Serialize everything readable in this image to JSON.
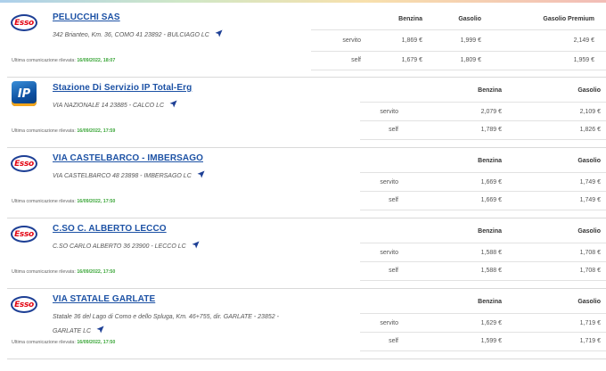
{
  "stations": [
    {
      "logo": "esso",
      "logo_text": "Esso",
      "name": "PELUCCHI SAS",
      "address_lines": [
        "342 Brianteo, Km. 36, COMO 41 23892 - BULCIAGO LC"
      ],
      "last_update_label": "Ultima comunicazione rilevata:",
      "last_update_date": "16/09/2022, 18:07",
      "fuels": [
        "Benzina",
        "Gasolio",
        "Gasolio Premium"
      ],
      "rows": [
        {
          "label": "servito",
          "prices": [
            "1,869 €",
            "1,999 €",
            "2,149 €"
          ]
        },
        {
          "label": "self",
          "prices": [
            "1,679 €",
            "1,809 €",
            "1,959 €"
          ]
        }
      ]
    },
    {
      "logo": "ip",
      "logo_text": "IP",
      "name": "Stazione Di Servizio IP Total-Erg",
      "address_lines": [
        "VIA NAZIONALE 14 23885 - CALCO LC"
      ],
      "last_update_label": "Ultima comunicazione rilevata:",
      "last_update_date": "16/09/2022, 17:59",
      "fuels": [
        "Benzina",
        "Gasolio"
      ],
      "rows": [
        {
          "label": "servito",
          "prices": [
            "2,079 €",
            "2,109 €"
          ]
        },
        {
          "label": "self",
          "prices": [
            "1,789 €",
            "1,826 €"
          ]
        }
      ]
    },
    {
      "logo": "esso",
      "logo_text": "Esso",
      "name": "VIA CASTELBARCO - IMBERSAGO",
      "address_lines": [
        "VIA CASTELBARCO 48 23898 - IMBERSAGO LC"
      ],
      "last_update_label": "Ultima comunicazione rilevata:",
      "last_update_date": "16/09/2022, 17:50",
      "fuels": [
        "Benzina",
        "Gasolio"
      ],
      "rows": [
        {
          "label": "servito",
          "prices": [
            "1,669 €",
            "1,749 €"
          ]
        },
        {
          "label": "self",
          "prices": [
            "1,669 €",
            "1,749 €"
          ]
        }
      ]
    },
    {
      "logo": "esso",
      "logo_text": "Esso",
      "name": "C.SO C. ALBERTO LECCO",
      "address_lines": [
        "C.SO CARLO ALBERTO 36 23900 - LECCO LC"
      ],
      "last_update_label": "Ultima comunicazione rilevata:",
      "last_update_date": "16/09/2022, 17:50",
      "fuels": [
        "Benzina",
        "Gasolio"
      ],
      "rows": [
        {
          "label": "servito",
          "prices": [
            "1,588 €",
            "1,708 €"
          ]
        },
        {
          "label": "self",
          "prices": [
            "1,588 €",
            "1,708 €"
          ]
        }
      ]
    },
    {
      "logo": "esso",
      "logo_text": "Esso",
      "name": "VIA STATALE GARLATE",
      "address_lines": [
        "Statale 36 del Lago di Como e dello Spluga, Km. 46+755, dir. GARLATE - 23852 -",
        "GARLATE LC"
      ],
      "last_update_label": "Ultima comunicazione rilevata:",
      "last_update_date": "16/09/2022, 17:50",
      "fuels": [
        "Benzina",
        "Gasolio"
      ],
      "rows": [
        {
          "label": "servito",
          "prices": [
            "1,629 €",
            "1,719 €"
          ]
        },
        {
          "label": "self",
          "prices": [
            "1,599 €",
            "1,719 €"
          ]
        }
      ]
    }
  ],
  "colors": {
    "link": "#1d52a5",
    "update_date": "#39a537",
    "esso_red": "#e30613",
    "esso_blue": "#1d3f95"
  },
  "icons": {
    "nav": "navigation-arrow-icon"
  }
}
